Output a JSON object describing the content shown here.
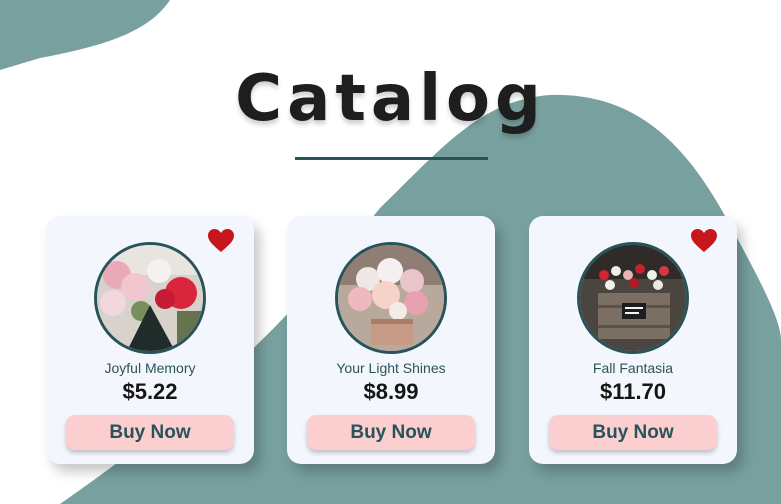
{
  "header": {
    "title": "Catalog"
  },
  "colors": {
    "accent": "#285459",
    "background_shape": "#77a09f",
    "card_background": "#f3f7fd",
    "button_background": "#fbcfcf",
    "heart": "#c8161d"
  },
  "products": [
    {
      "name": "Joyful Memory",
      "price": "$5.22",
      "button_label": "Buy Now",
      "favorited": true,
      "icon": "heart-icon"
    },
    {
      "name": "Your Light Shines",
      "price": "$8.99",
      "button_label": "Buy Now",
      "favorited": false,
      "icon": "heart-icon"
    },
    {
      "name": "Fall Fantasia",
      "price": "$11.70",
      "button_label": "Buy Now",
      "favorited": true,
      "icon": "heart-icon"
    }
  ]
}
